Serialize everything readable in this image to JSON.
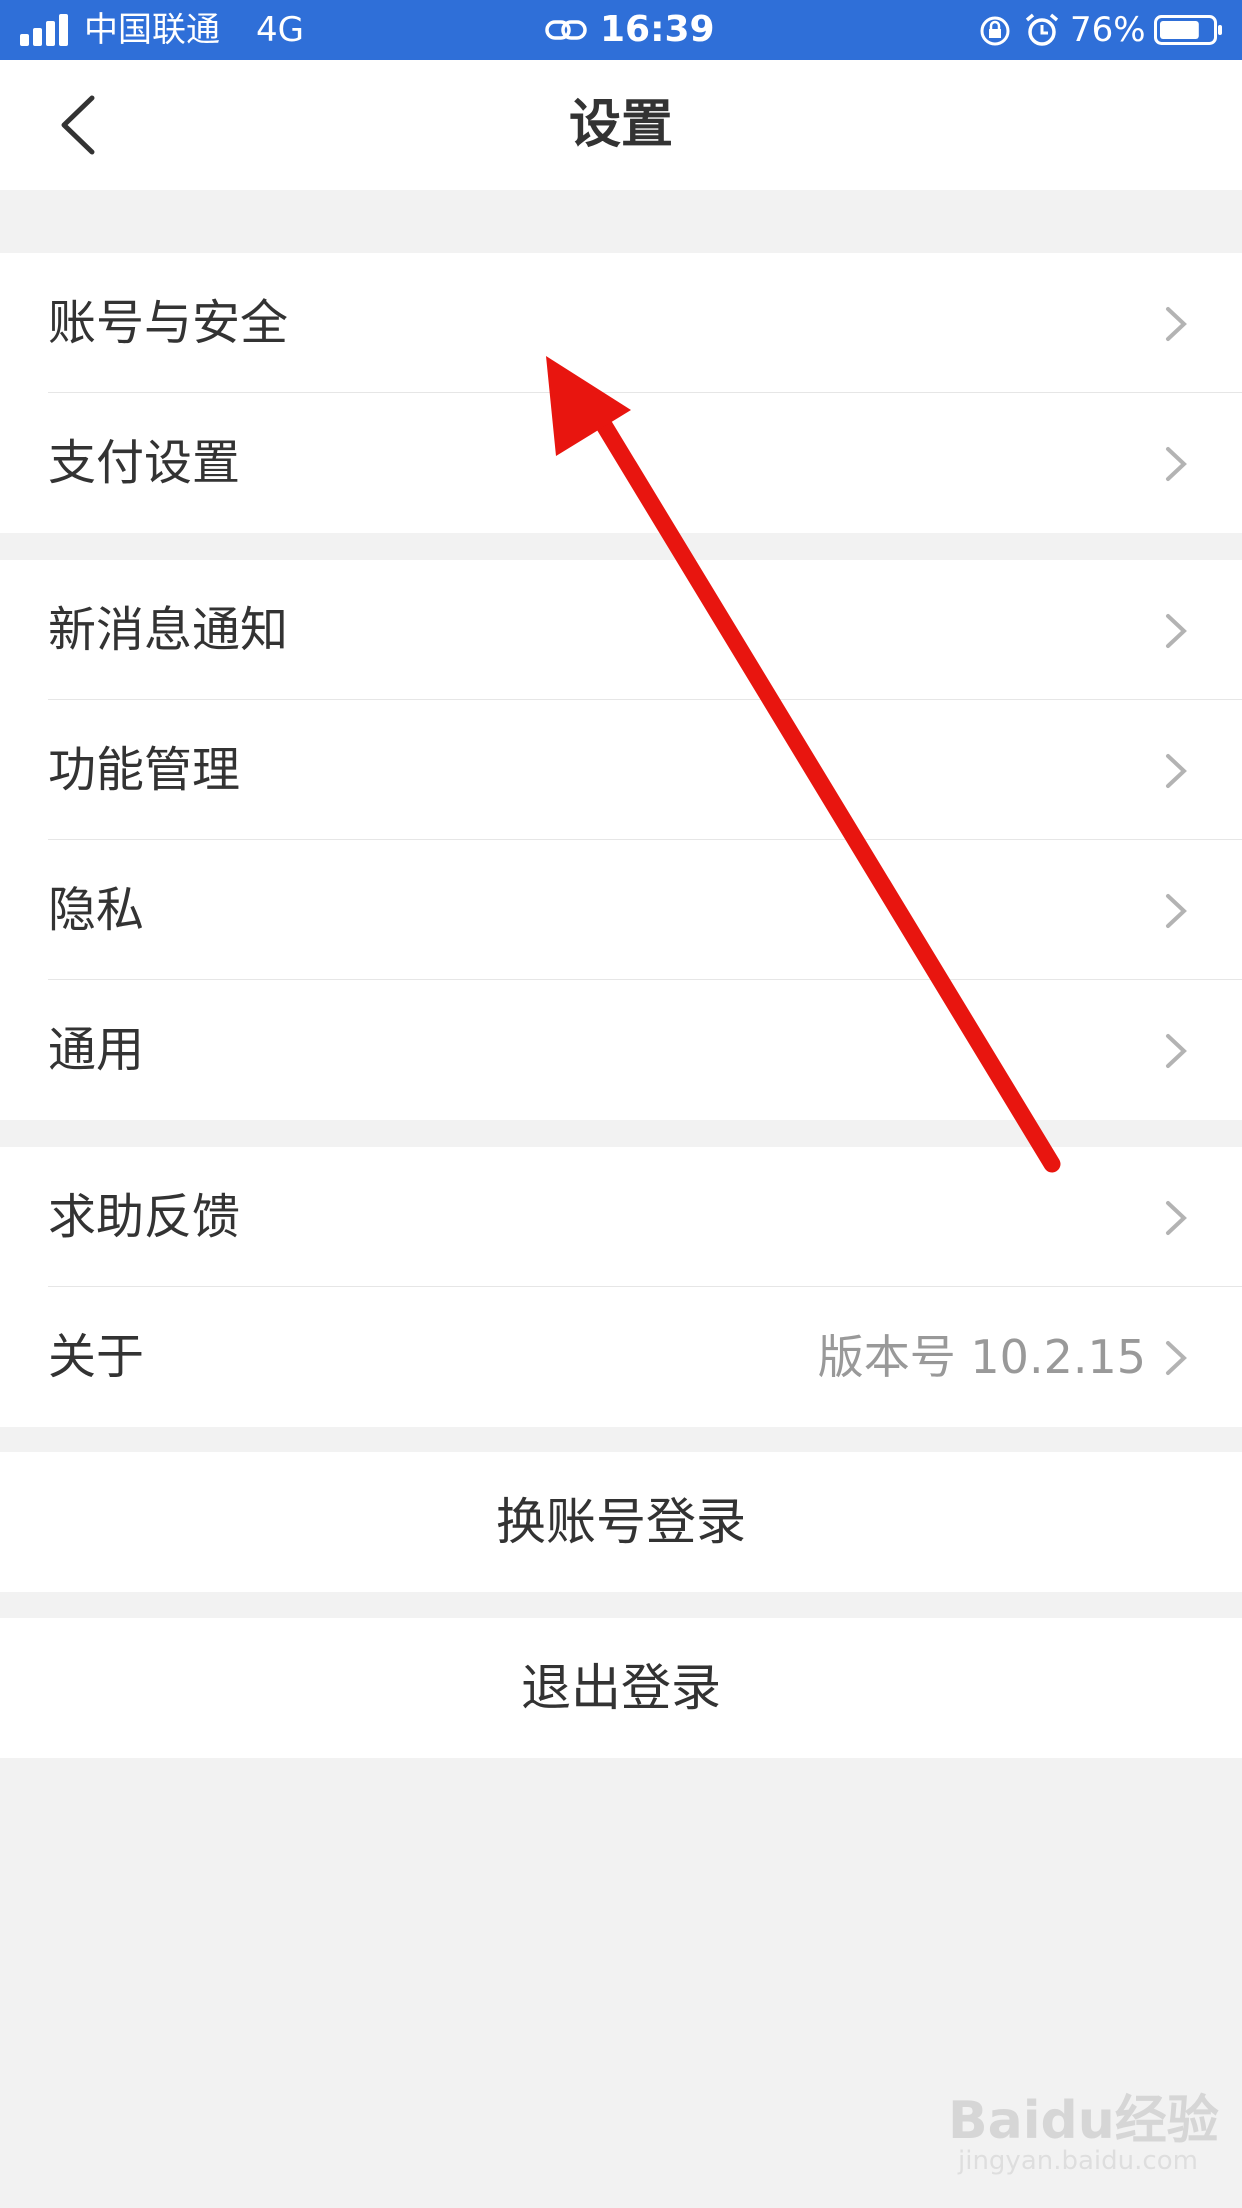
{
  "status_bar": {
    "carrier": "中国联通",
    "network": "4G",
    "time": "16:39",
    "battery_percent": "76%",
    "battery_level": 0.76,
    "icons": [
      "signal-icon",
      "link-icon",
      "orientation-lock-icon",
      "alarm-icon",
      "battery-icon"
    ]
  },
  "header": {
    "title": "设置",
    "back_icon": "chevron-left-icon"
  },
  "groups": [
    {
      "items": [
        {
          "label": "账号与安全"
        },
        {
          "label": "支付设置"
        }
      ]
    },
    {
      "items": [
        {
          "label": "新消息通知"
        },
        {
          "label": "功能管理"
        },
        {
          "label": "隐私"
        },
        {
          "label": "通用"
        }
      ]
    },
    {
      "items": [
        {
          "label": "求助反馈"
        },
        {
          "label": "关于",
          "value": "版本号 10.2.15"
        }
      ]
    }
  ],
  "actions": {
    "switch_account": "换账号登录",
    "logout": "退出登录"
  },
  "watermark": {
    "brand": "Baidu经验",
    "url": "jingyan.baidu.com"
  },
  "colors": {
    "status_bar_bg": "#2f6fd8",
    "page_bg": "#f2f2f2",
    "arrow": "#e8150f"
  }
}
